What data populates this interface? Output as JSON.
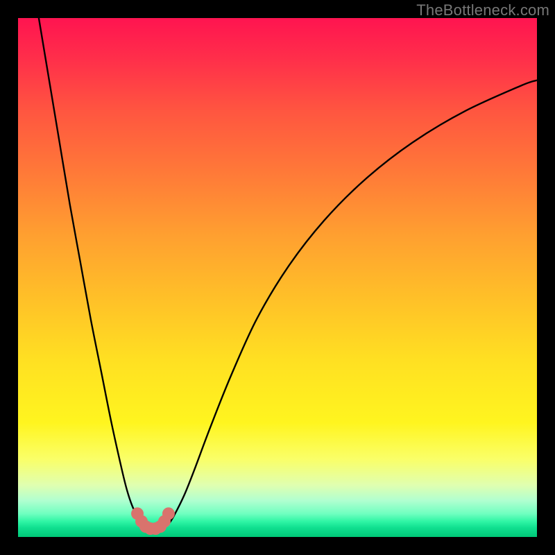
{
  "watermark": "TheBottleneck.com",
  "chart_data": {
    "type": "line",
    "title": "",
    "xlabel": "",
    "ylabel": "",
    "xlim": [
      0,
      100
    ],
    "ylim": [
      0,
      100
    ],
    "series": [
      {
        "name": "left-curve",
        "x": [
          4,
          6,
          8,
          10,
          12,
          14,
          16,
          18,
          20,
          21,
          22,
          23,
          24,
          25
        ],
        "values": [
          100,
          88,
          76,
          64,
          53,
          42,
          32,
          22,
          13,
          9,
          6,
          4,
          2.5,
          1.8
        ]
      },
      {
        "name": "right-curve",
        "x": [
          28,
          29,
          30,
          32,
          34,
          37,
          41,
          46,
          52,
          59,
          67,
          76,
          86,
          97,
          100
        ],
        "values": [
          1.8,
          2.5,
          4,
          8,
          13,
          21,
          31,
          42,
          52,
          61,
          69,
          76,
          82,
          87,
          88
        ]
      },
      {
        "name": "bottleneck-marker",
        "x": [
          23,
          23.8,
          24.6,
          25.5,
          26.5,
          27.4,
          28.2,
          29
        ],
        "values": [
          4.5,
          3.0,
          2.0,
          1.6,
          1.6,
          2.0,
          3.0,
          4.5
        ]
      }
    ],
    "marker_color": "#d9736d",
    "curve_color": "#000000"
  }
}
